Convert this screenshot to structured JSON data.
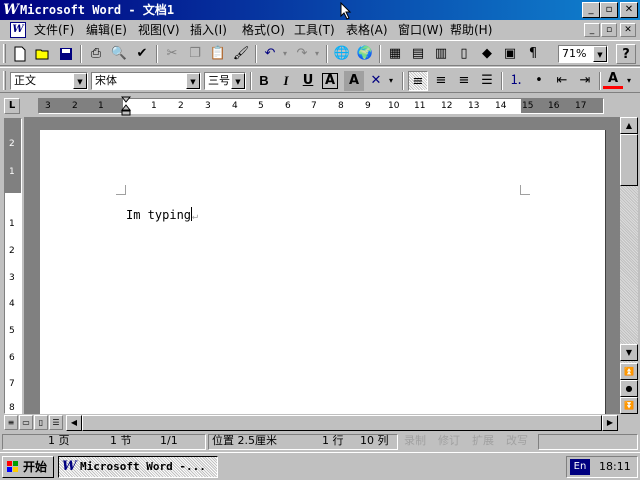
{
  "window": {
    "app_icon": "W",
    "title": "Microsoft Word - 文档1",
    "minimize_label": "_",
    "restore_label": "▫",
    "close_label": "✕"
  },
  "menu": {
    "doc_icon": "W",
    "items": [
      "文件(F)",
      "编辑(E)",
      "视图(V)",
      "插入(I)",
      "格式(O)",
      "工具(T)",
      "表格(A)",
      "窗口(W)",
      "帮助(H)"
    ]
  },
  "standard_toolbar": {
    "zoom": "71%",
    "help_label": "?"
  },
  "formatting_toolbar": {
    "style": "正文",
    "font": "宋体",
    "size": "三号",
    "bold": "B",
    "italic": "I",
    "underline": "U",
    "char_border": "A",
    "char_shading": "A",
    "font_color": "A"
  },
  "ruler": {
    "tab_selector": "L",
    "horizontal_numbers": [
      "3",
      "2",
      "1",
      "1",
      "2",
      "3",
      "4",
      "5",
      "6",
      "7",
      "8",
      "9",
      "10",
      "11",
      "12",
      "13",
      "14",
      "15",
      "16",
      "17"
    ],
    "vertical_numbers": [
      "2",
      "1",
      "1",
      "2",
      "3",
      "4",
      "5",
      "6",
      "7",
      "8"
    ]
  },
  "document": {
    "text": "Im typing",
    "paragraph_mark": "↵"
  },
  "status": {
    "page": "1 页",
    "section": "1 节",
    "page_of": "1/1",
    "position": "位置 2.5厘米",
    "line": "1 行",
    "column": "10 列",
    "rec": "录制",
    "trk": "修订",
    "ext": "扩展",
    "ovr": "改写"
  },
  "taskbar": {
    "start_label": "开始",
    "task_label": "Microsoft Word -...",
    "ime": "En",
    "clock": "18:11"
  },
  "colors": {
    "title_bar": "#000080",
    "font_color_swatch": "#ff0000",
    "desktop_grey": "#c0c0c0"
  }
}
